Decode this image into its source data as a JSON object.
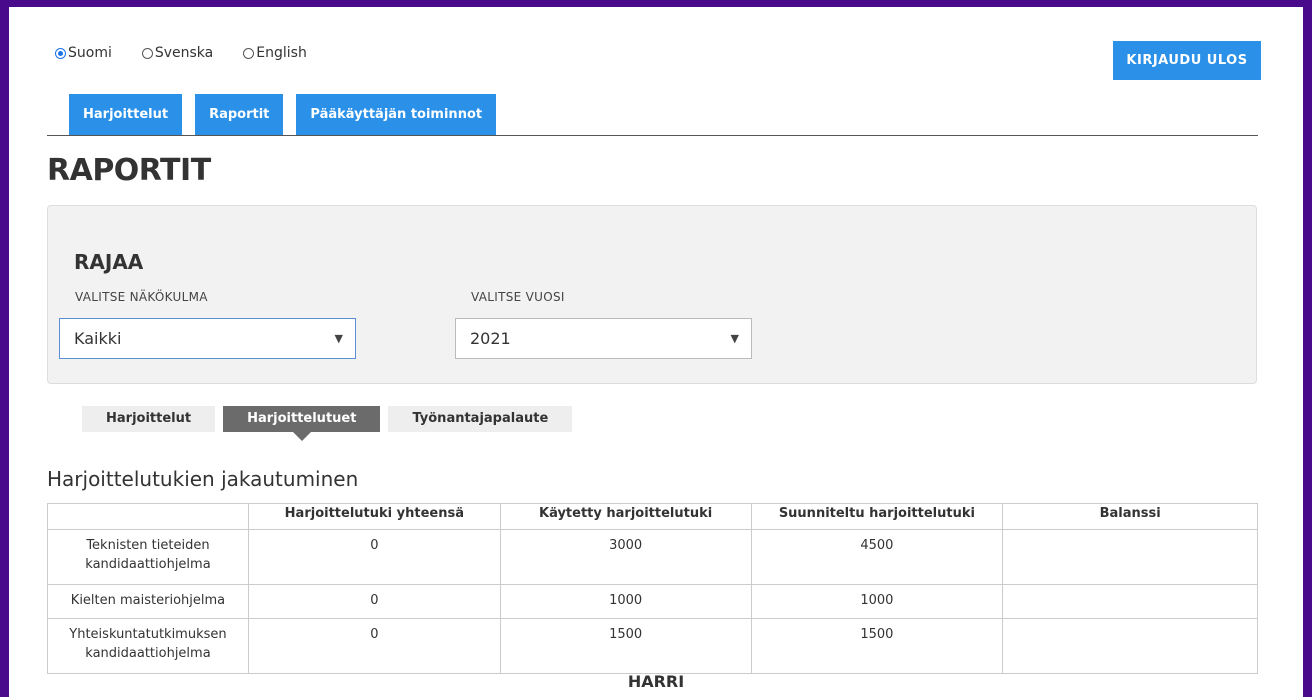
{
  "languages": [
    {
      "label": "Suomi",
      "selected": true
    },
    {
      "label": "Svenska",
      "selected": false
    },
    {
      "label": "English",
      "selected": false
    }
  ],
  "logout_label": "KIRJAUDU ULOS",
  "nav_tabs": [
    "Harjoittelut",
    "Raportit",
    "Pääkäyttäjän toiminnot"
  ],
  "page_title": "RAPORTIT",
  "filter": {
    "title": "RAJAA",
    "perspective_label": "VALITSE NÄKÖKULMA",
    "perspective_value": "Kaikki",
    "year_label": "VALITSE VUOSI",
    "year_value": "2021"
  },
  "sub_tabs": [
    "Harjoittelut",
    "Harjoittelutuet",
    "Työnantajapalaute"
  ],
  "active_sub_tab": "Harjoittelutuet",
  "section_title": "Harjoittelutukien jakautuminen",
  "table": {
    "headers": [
      "",
      "Harjoittelutuki yhteensä",
      "Käytetty harjoittelutuki",
      "Suunniteltu harjoittelutuki",
      "Balanssi"
    ],
    "rows": [
      [
        "Teknisten tieteiden kandidaattiohjelma",
        "0",
        "3000",
        "4500",
        ""
      ],
      [
        "Kielten maisteriohjelma",
        "0",
        "1000",
        "1000",
        ""
      ],
      [
        "Yhteiskuntatutkimuksen kandidaattiohjelma",
        "0",
        "1500",
        "1500",
        ""
      ]
    ]
  },
  "footer": "HARRI",
  "colors": {
    "background": "#4a0a8c",
    "accent": "#2a90e8",
    "active_subtab": "#6b6b6b"
  }
}
